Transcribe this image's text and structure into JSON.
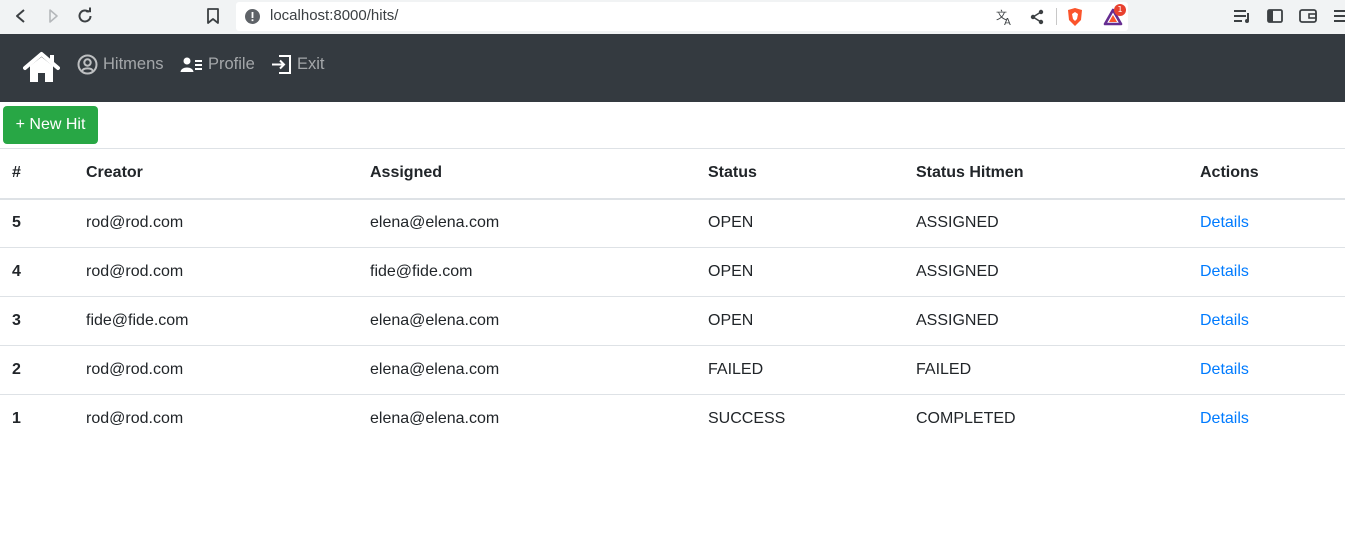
{
  "browser": {
    "url": "localhost:8000/hits/",
    "notification_count": "1",
    "icons": [
      "back-icon",
      "forward-icon",
      "reload-icon",
      "bookmark-icon",
      "site-info-icon",
      "translate-icon",
      "share-icon",
      "brave-shield-icon",
      "brave-rewards-icon",
      "playlist-icon",
      "sidebar-icon",
      "wallet-icon",
      "menu-icon"
    ]
  },
  "navbar": {
    "brand_icon": "home-icon",
    "items": [
      {
        "label": "Hitmens",
        "icon": "user-circle-icon"
      },
      {
        "label": "Profile",
        "icon": "profile-card-icon"
      },
      {
        "label": "Exit",
        "icon": "exit-icon"
      }
    ]
  },
  "actions": {
    "new_hit_label": "+ New Hit"
  },
  "table": {
    "headers": [
      "#",
      "Creator",
      "Assigned",
      "Status",
      "Status Hitmen",
      "Actions"
    ],
    "rows": [
      {
        "id": "5",
        "creator": "rod@rod.com",
        "assigned": "elena@elena.com",
        "status": "OPEN",
        "status_hitmen": "ASSIGNED",
        "action": "Details"
      },
      {
        "id": "4",
        "creator": "rod@rod.com",
        "assigned": "fide@fide.com",
        "status": "OPEN",
        "status_hitmen": "ASSIGNED",
        "action": "Details"
      },
      {
        "id": "3",
        "creator": "fide@fide.com",
        "assigned": "elena@elena.com",
        "status": "OPEN",
        "status_hitmen": "ASSIGNED",
        "action": "Details"
      },
      {
        "id": "2",
        "creator": "rod@rod.com",
        "assigned": "elena@elena.com",
        "status": "FAILED",
        "status_hitmen": "FAILED",
        "action": "Details"
      },
      {
        "id": "1",
        "creator": "rod@rod.com",
        "assigned": "elena@elena.com",
        "status": "SUCCESS",
        "status_hitmen": "COMPLETED",
        "action": "Details"
      }
    ]
  },
  "colors": {
    "navbar_bg": "#343a40",
    "success": "#28a745",
    "link": "#007bff"
  }
}
